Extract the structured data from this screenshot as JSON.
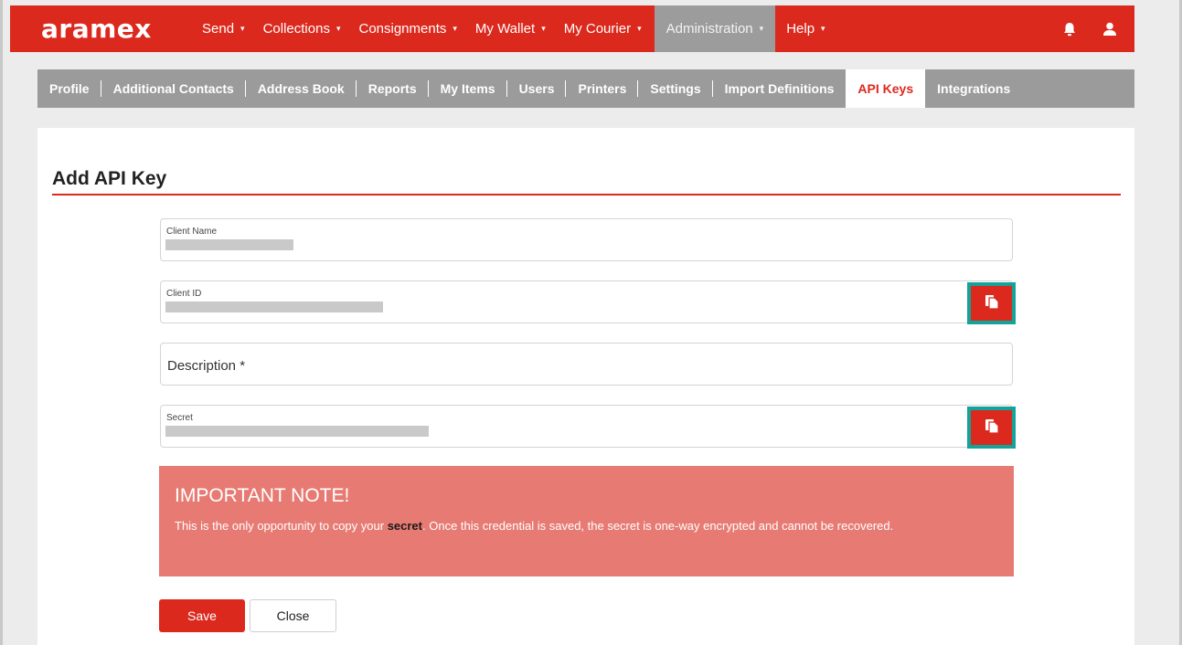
{
  "brand": {
    "logo_text": "aramex",
    "accent": "#dc291e",
    "highlight": "#14a39a"
  },
  "topnav": {
    "items": [
      {
        "label": "Send",
        "caret": "▾"
      },
      {
        "label": "Collections",
        "caret": "▾"
      },
      {
        "label": "Consignments",
        "caret": "▾"
      },
      {
        "label": "My Wallet",
        "caret": "▾"
      },
      {
        "label": "My Courier",
        "caret": "▾"
      },
      {
        "label": "Administration",
        "caret": "▾",
        "active": true
      },
      {
        "label": "Help",
        "caret": "▾"
      }
    ],
    "icons": [
      "bell-icon",
      "user-icon"
    ]
  },
  "subnav": {
    "items": [
      {
        "label": "Profile"
      },
      {
        "label": "Additional Contacts"
      },
      {
        "label": "Address Book"
      },
      {
        "label": "Reports"
      },
      {
        "label": "My Items"
      },
      {
        "label": "Users"
      },
      {
        "label": "Printers"
      },
      {
        "label": "Settings"
      },
      {
        "label": "Import Definitions"
      },
      {
        "label": "API Keys",
        "active": true
      },
      {
        "label": "Integrations"
      }
    ]
  },
  "form": {
    "title": "Add API Key",
    "client_name_label": "Client Name",
    "client_id_label": "Client ID",
    "description_placeholder": "Description *",
    "secret_label": "Secret"
  },
  "note": {
    "title": "IMPORTANT NOTE!",
    "body_before": "This is the only opportunity to copy your ",
    "body_bold": "secret",
    "body_after": ". Once this credential is saved, the secret is one-way encrypted and cannot be recovered."
  },
  "actions": {
    "save_label": "Save",
    "close_label": "Close"
  }
}
